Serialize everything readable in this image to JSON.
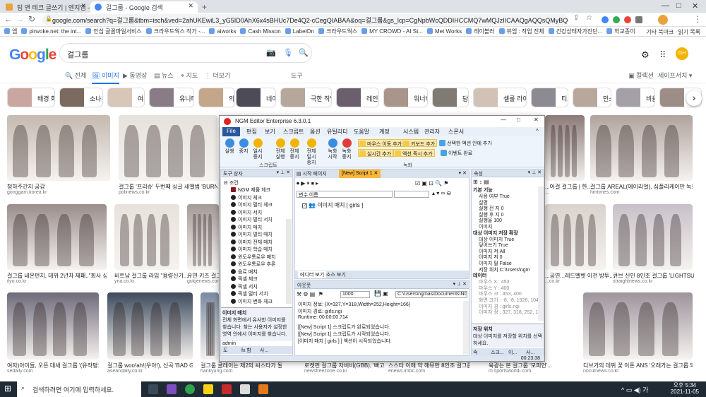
{
  "browser": {
    "tabs": [
      {
        "title": "팁 앤 테크 글쓰기 | 엔지엠 - 엔지엠 ..."
      },
      {
        "title": "걸그룹 - Google 검색"
      }
    ],
    "new_tab": "+",
    "url": "google.com/search?q=걸그룹&tbm=isch&ved=2ahUKEwiL3_yG5ID0AhX6x4sBHUc7De4Q2-cCegQIABAA&oq=걸그룹&gs_lcp=CgNpbWcQDDIHCCMQ7wMQJzIICAAQgAQQsQMyBQgAEIAEMgUIABCABDIFCAAQg...",
    "bookmarks": [
      "앱",
      "pinvoke.net: the int...",
      "안심 글꼴파일서비스",
      "크라우드웍스 작가 -...",
      "aiworks",
      "Cash Misson",
      "LabelOn",
      "크라우드웍스",
      "MY CROWD - AI St...",
      "Met Works",
      "레이블러",
      "뷰엠 : 작업 진체",
      "건강상태자가진단...",
      "학교종이"
    ],
    "bookmarks_right": [
      "기타 북마크",
      "읽기 목록"
    ]
  },
  "google": {
    "logo": "Google",
    "query": "걸그룹",
    "tabs": [
      "전체",
      "이미지",
      "동영상",
      "뉴스",
      "지도",
      "더보기",
      "도구"
    ],
    "right_links": [
      "컬렉션",
      "세이프서치 ▾"
    ],
    "avatar": "GH",
    "chips": [
      "배경 화면",
      "소나무",
      "여름",
      "유니티",
      "의상",
      "네이처",
      "극한 직업",
      "레인보우",
      "워너비",
      "담배",
      "셀룰 라이트",
      "티트",
      "민소매",
      "비율",
      "병"
    ],
    "results": [
      {
        "caption": "청하주간지 공감",
        "source": "gonggam.korea.kr"
      },
      {
        "caption": "걸그룹 '프리슈' 두번째 싱글 새앨범 'BURN IT'...",
        "source": "polinews.co.kr"
      },
      {
        "caption": "...어걸 걸그룹 | 한...",
        "source": "..."
      },
      {
        "caption": "걸그룹 AREAL(에이리얼), 심플리케이만 녹화로...",
        "source": "hmtimes.com"
      },
      {
        "caption": "걸그룹 네온펀치, 데뷔 2년차 재패..\"회사 상황...",
        "source": "ilyo.co.kr"
      },
      {
        "caption": "비트남 걸그룹 라임 \"용량신기...",
        "source": "yna.co.kr"
      },
      {
        "caption": "유연 키즈 걸그룹...",
        "source": "gukjenews.com"
      },
      {
        "caption": "...공연...레드벨벳 이전 방투...",
        "source": "...co.kr"
      },
      {
        "caption": "큐브 신인 8인조 걸그룹 'LIGHTSUM(...",
        "source": "straightnews.co.kr"
      },
      {
        "caption": "여자)아이들, 오픈 대세 걸그룹 '(유작평크...",
        "source": "sedaily.com"
      },
      {
        "caption": "걸그룹 woo!ah!(우아!), 신곡 'BAD GIRL'...",
        "source": "aseandaily.co.kr"
      },
      {
        "caption": "걸그룹 클레이는 제2의 씨스타가 될 수 있을...",
        "source": "hankyung.com"
      },
      {
        "caption": "로켓펀 걸그룹 자비비(GBB), '빠고 한...",
        "source": "newsfreezone.co.kr"
      },
      {
        "caption": "스스타 이해 약 해뮤한 8인조 걸그룹 '네이...",
        "source": "enews.imbc.com"
      },
      {
        "caption": "육광는 본 걸그룹 '모피언'...",
        "source": "m.sportsworldi.com"
      },
      {
        "caption": "디브가의 데뷔 꽃 이폰 ANS '오래가는 걸그룹 되고...",
        "source": "nocutnews.co.kr"
      }
    ]
  },
  "ngm": {
    "title": "NGM Editor   Enterprise 6.3.0.1",
    "menu": [
      "File",
      "편집",
      "보기",
      "스크립트",
      "옵션",
      "유틸리티",
      "도움말",
      "계정",
      "시스템",
      "관리자",
      "스폰서"
    ],
    "ribbon_buttons": [
      "실행",
      "중지",
      "일시 중지",
      "전체 실행",
      "전체 중지",
      "전체 일시 중지",
      "녹화 시작",
      "녹화 중지"
    ],
    "ribbon_small": [
      "마우스 이동 추가",
      "키보드 추가",
      "선택한 액션 안에 추가",
      "실시간 추가",
      "액션 즉시 추가",
      "이벤트 완료"
    ],
    "ribbon_groups": [
      "스크립트",
      "녹화"
    ],
    "toolbox": {
      "header": "도구 상자",
      "root": "조건",
      "items": [
        "NGM 제품 체크",
        "이미지 체크",
        "이미지 멀티 체크",
        "이미지 서치",
        "이미지 멀티 서치",
        "이미지 매치",
        "이미지 멀티 매치",
        "이미지 전체 매치",
        "이미지 학습 매치",
        "윈도우통로우 매치",
        "윈도우통로우 추론",
        "음료 매치",
        "픽셀 체크",
        "픽셀 서치",
        "픽셀 멀티 서치",
        "이미지 변화 체크"
      ],
      "desc_title": "이미지 매치",
      "desc": "전체 화면에서 유사한 이미지를 찾습니다. 찾는 사용자가 설정한 영역 안에서 이미지를 찾습니다.",
      "tabs": [
        "도",
        "fx 함",
        "사..."
      ]
    },
    "script": {
      "tabs": [
        "시작 페이지",
        "[New] Script 1"
      ],
      "var_label": "변수 이름",
      "node": "이미지 매치 [ girls ]",
      "bottom_tabs": [
        "에디터 보기",
        "소스 보기"
      ]
    },
    "output": {
      "header": "아웃풋",
      "delay": "1000",
      "path": "C:\\Users\\ngmas\\Documents\\NGM\\",
      "lines": [
        "이미지 정보: {X=327,Y=318,Width=252,Height=166}",
        "이미지 경로: girls.ngi",
        "Runtime: 00:00:00.714",
        "[[New] Script 1] 스크립트가 완료되었습니다.",
        "[[New] Script 1] 스크립트가 시작되었습니다.",
        "[이미지 매치 [ girls ] ] 액션이 시작되었습니다."
      ]
    },
    "props": {
      "header": "속성",
      "sections": [
        {
          "title": "기본 기능",
          "rows": [
            "사용 여부  True",
            "설명",
            "실행 전 지 0",
            "실행 후 지 0",
            "실행율     100",
            "이미지"
          ]
        },
        {
          "title": "대상 이미지 저장 확장",
          "rows": [
            "대상 이미지  True",
            "덮어쓰기  True",
            "이미지 저 All",
            "이미지 저 0",
            "이미지 필 False",
            "저장 위치  C:\\Users\\ngm"
          ]
        },
        {
          "title": "데이터",
          "rows": [
            "마우스 X : 453",
            "마우스 Y : 400",
            "마우스 크 : 453, 400",
            "화면 크기 : -8, -8, 1928, 1048",
            "이미지 경 : girls.ngi",
            "이미지 정 : 327, 318, 252, 166"
          ]
        }
      ],
      "desc_title": "저장 위치",
      "desc": "대상 이미지를 저장할 위치를 선택 하세요.",
      "tabs": [
        "속",
        "스크...",
        "이...",
        "사..."
      ]
    },
    "status": {
      "user": "admin",
      "time": "00:23:38"
    }
  },
  "taskbar": {
    "search_placeholder": "검색하려면 여기에 입력하세요.",
    "time": "오후 5:34",
    "date": "2021-11-05"
  },
  "colors": {
    "google_blue": "#1a73e8",
    "ngm_blue": "#2b579a",
    "taskbar": "#1f2a35"
  }
}
